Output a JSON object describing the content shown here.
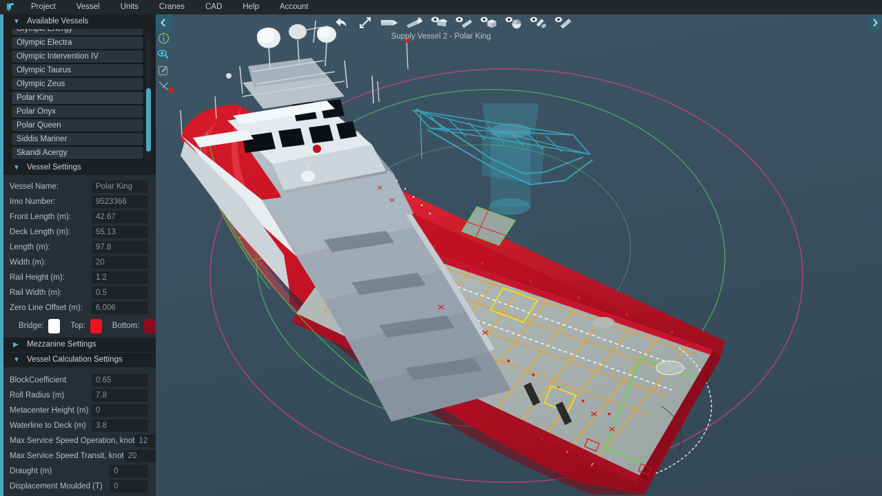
{
  "app": {
    "logo_icon": "app-logo-icon",
    "accent_color": "#4da6bd",
    "viewport_bg_top": "#3d5565",
    "viewport_bg_bottom": "#334854"
  },
  "menubar": {
    "items": [
      {
        "label": "Project"
      },
      {
        "label": "Vessel"
      },
      {
        "label": "Units"
      },
      {
        "label": "Cranes"
      },
      {
        "label": "CAD"
      },
      {
        "label": "Help"
      },
      {
        "label": "Account"
      }
    ]
  },
  "sidebar": {
    "available_vessels": {
      "title": "Available Vessels",
      "expanded": true,
      "chevron": "chevron-down-icon",
      "items": [
        {
          "label": "Olympic Energy",
          "selected": false
        },
        {
          "label": "Olympic Electra",
          "selected": false
        },
        {
          "label": "Olympic Intervention IV",
          "selected": false
        },
        {
          "label": "Olympic Taurus",
          "selected": false
        },
        {
          "label": "Olympic Zeus",
          "selected": false
        },
        {
          "label": "Polar King",
          "selected": true
        },
        {
          "label": "Polar Onyx",
          "selected": false
        },
        {
          "label": "Polar Queen",
          "selected": false
        },
        {
          "label": "Siddis Mariner",
          "selected": false
        },
        {
          "label": "Skandi Acergy",
          "selected": false
        }
      ]
    },
    "vessel_settings": {
      "title": "Vessel Settings",
      "expanded": true,
      "chevron": "chevron-down-icon",
      "fields": [
        {
          "label": "Vessel Name:",
          "value": "Polar King"
        },
        {
          "label": "Imo Number:",
          "value": "9523366"
        },
        {
          "label": "Front Length (m):",
          "value": "42.67"
        },
        {
          "label": "Deck Length (m):",
          "value": "55.13"
        },
        {
          "label": "Length (m):",
          "value": "97.8"
        },
        {
          "label": "Width (m):",
          "value": "20"
        },
        {
          "label": "Rail Height (m):",
          "value": "1.2"
        },
        {
          "label": "Rail Width (m):",
          "value": "0.5"
        },
        {
          "label": "Zero Line Offset (m):",
          "value": "6.006"
        }
      ],
      "colors": [
        {
          "label": "Bridge:",
          "color": "#fdfdfd"
        },
        {
          "label": "Top:",
          "color": "#ee1122"
        },
        {
          "label": "Bottom:",
          "color": "#8f0a20"
        }
      ]
    },
    "mezzanine_settings": {
      "title": "Mezzanine Settings",
      "expanded": false,
      "chevron": "chevron-right-icon"
    },
    "vessel_calculation_settings": {
      "title": "Vessel Calculation Settings",
      "expanded": true,
      "chevron": "chevron-down-icon",
      "fields": [
        {
          "label": "BlockCoefficient",
          "value": "0.65",
          "narrow": false
        },
        {
          "label": "Roll Radius (m)",
          "value": "7.8",
          "narrow": false
        },
        {
          "label": "Metacenter Height (m)",
          "value": "0",
          "narrow": false
        },
        {
          "label": "Waterline to Deck (m)",
          "value": "3.8",
          "narrow": false
        },
        {
          "label": "Max Service Speed Operation, knot",
          "value": "12",
          "narrow": true
        },
        {
          "label": "Max Service Speed Transit, knot",
          "value": "20",
          "narrow": true
        },
        {
          "label": "Draught (m)",
          "value": "0",
          "narrow": true
        },
        {
          "label": "Displacement Moulded (T)",
          "value": "0",
          "narrow": true
        }
      ]
    }
  },
  "icon_strip": {
    "buttons": [
      {
        "name": "collapse-panel-chevron-left-icon",
        "active": true
      },
      {
        "name": "info-circle-icon",
        "active": false
      },
      {
        "name": "visibility-eye-icon",
        "active": false
      },
      {
        "name": "edit-square-icon",
        "active": false
      },
      {
        "name": "measure-line-icon",
        "active": false
      }
    ]
  },
  "toolbar": {
    "buttons": [
      {
        "name": "back-arrow-icon"
      },
      {
        "name": "expand-fullscreen-icon"
      },
      {
        "name": "vessel-side-view-icon"
      },
      {
        "name": "vessel-perspective-view-icon"
      },
      {
        "name": "show-deck-icon"
      },
      {
        "name": "show-ruler-icon"
      },
      {
        "name": "show-cube-icon"
      },
      {
        "name": "show-pie-icon"
      },
      {
        "name": "show-cargo-icon"
      },
      {
        "name": "show-measure-icon"
      }
    ]
  },
  "viewport": {
    "caption": "Supply Vessel 2 - Polar King",
    "expand_right_chevron": "chevron-right-icon"
  }
}
